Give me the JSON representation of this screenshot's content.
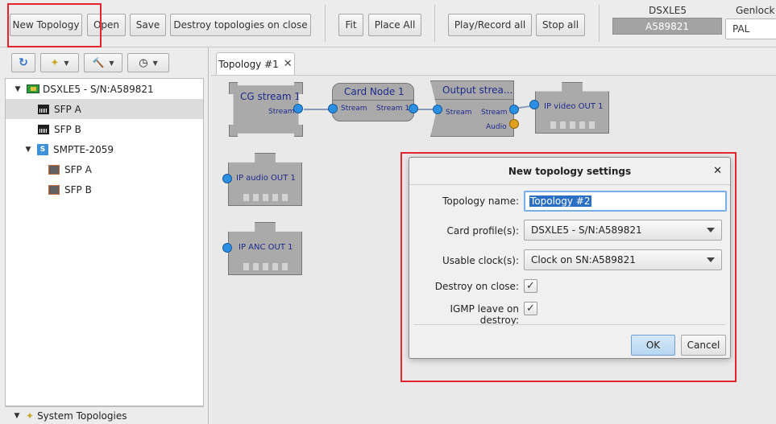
{
  "toolbar": {
    "new_topology": "New Topology",
    "open": "Open",
    "save": "Save",
    "destroy_on_close": "Destroy topologies on close",
    "fit": "Fit",
    "place_all": "Place All",
    "play_record_all": "Play/Record all",
    "stop_all": "Stop all",
    "device_label": "DSXLE5",
    "device_serial": "A589821",
    "genlock_label": "Genlock",
    "genlock_value": "PAL"
  },
  "tree": {
    "items": [
      {
        "label": "DSXLE5 - S/N:A589821"
      },
      {
        "label": "SFP A"
      },
      {
        "label": "SFP B"
      },
      {
        "label": "SMPTE-2059"
      },
      {
        "label": "SFP A"
      },
      {
        "label": "SFP B"
      }
    ],
    "system_topologies": "System Topologies"
  },
  "tab": {
    "label": "Topology #1"
  },
  "nodes": {
    "cg_stream": {
      "title": "CG stream 1",
      "port": "Stream"
    },
    "card_node": {
      "title": "Card Node 1",
      "in_port": "Stream",
      "out_port": "Stream 1"
    },
    "output_stream": {
      "title": "Output strea...",
      "in_port": "Stream",
      "out_port": "Stream",
      "audio_port": "Audio"
    },
    "ip_video": {
      "title": "IP video OUT 1"
    },
    "ip_audio": {
      "title": "IP audio OUT 1"
    },
    "ip_anc": {
      "title": "IP ANC OUT 1"
    }
  },
  "dialog": {
    "title": "New topology settings",
    "topology_name_label": "Topology name:",
    "topology_name_value": "Topology #2",
    "card_profiles_label": "Card profile(s):",
    "card_profiles_value": "DSXLE5 - S/N:A589821",
    "usable_clocks_label": "Usable clock(s):",
    "usable_clocks_value": "Clock on SN:A589821",
    "destroy_on_close_label": "Destroy on close:",
    "destroy_on_close_checked": true,
    "igmp_leave_label": "IGMP leave on destroy:",
    "igmp_leave_checked": true,
    "ok": "OK",
    "cancel": "Cancel"
  },
  "colors": {
    "highlight": "#e4262c",
    "port": "#2b8fe3",
    "audio_port": "#e0a21c",
    "node_title": "#1f2a8a"
  }
}
